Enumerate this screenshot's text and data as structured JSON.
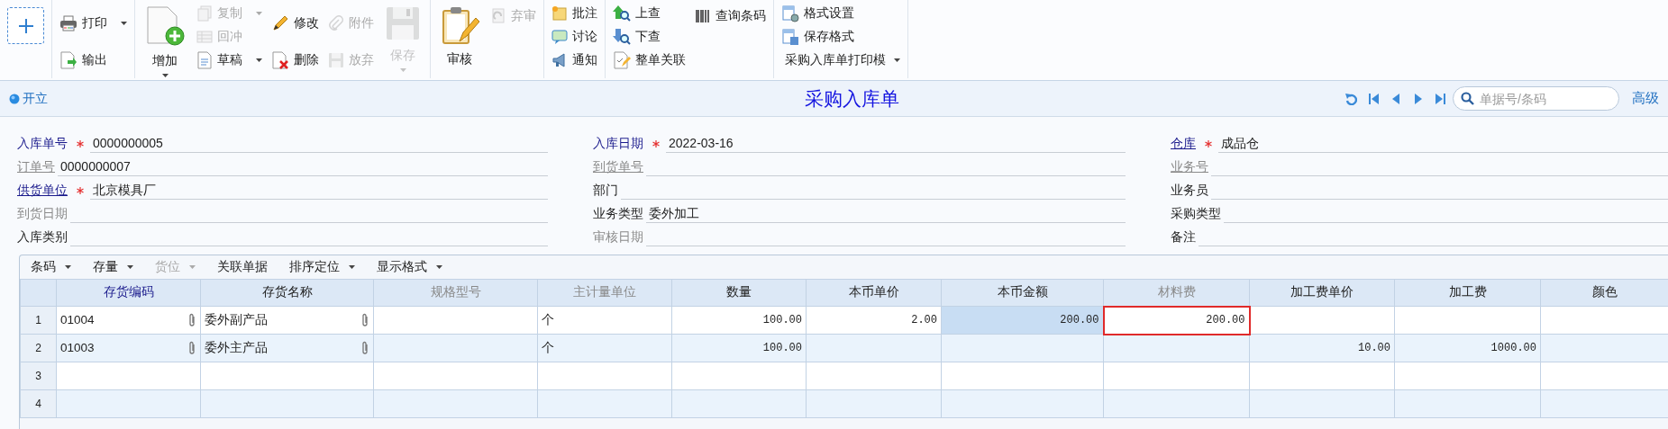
{
  "toolbar": {
    "groups": [
      {
        "columns": [
          [
            {
              "kind": "plus",
              "disabled": false,
              "dropdown": false
            }
          ]
        ]
      },
      {
        "columns": [
          [
            {
              "kind": "small",
              "label": "打印",
              "disabled": false,
              "dropdown": true
            },
            {
              "kind": "small",
              "label": "输出",
              "disabled": false,
              "dropdown": false
            }
          ]
        ]
      },
      {
        "columns": [
          [
            {
              "kind": "big",
              "label": "增加",
              "disabled": false,
              "dropdown": true
            }
          ],
          [
            {
              "kind": "small",
              "label": "复制",
              "disabled": true,
              "dropdown": true
            },
            {
              "kind": "small",
              "label": "回冲",
              "disabled": true,
              "dropdown": false
            },
            {
              "kind": "small",
              "label": "草稿",
              "disabled": false,
              "dropdown": true
            }
          ],
          [
            {
              "kind": "small",
              "label": "修改",
              "disabled": false,
              "dropdown": false
            },
            {
              "kind": "small",
              "label": "删除",
              "disabled": false,
              "dropdown": false
            }
          ],
          [
            {
              "kind": "small",
              "label": "附件",
              "disabled": true,
              "dropdown": false
            },
            {
              "kind": "small",
              "label": "放弃",
              "disabled": true,
              "dropdown": false
            }
          ],
          [
            {
              "kind": "big",
              "label": "保存",
              "disabled": true,
              "dropdown": true
            }
          ]
        ]
      },
      {
        "columns": [
          [
            {
              "kind": "big",
              "label": "审核",
              "disabled": false,
              "dropdown": false
            }
          ],
          [
            {
              "kind": "small",
              "label": "弃审",
              "disabled": true,
              "dropdown": false
            }
          ]
        ]
      },
      {
        "columns": [
          [
            {
              "kind": "small",
              "label": "批注",
              "disabled": false,
              "dropdown": false
            },
            {
              "kind": "small",
              "label": "讨论",
              "disabled": false,
              "dropdown": false
            },
            {
              "kind": "small",
              "label": "通知",
              "disabled": false,
              "dropdown": false
            }
          ]
        ]
      },
      {
        "columns": [
          [
            {
              "kind": "small",
              "label": "上查",
              "disabled": false,
              "dropdown": false
            },
            {
              "kind": "small",
              "label": "下查",
              "disabled": false,
              "dropdown": false
            },
            {
              "kind": "small",
              "label": "整单关联",
              "disabled": false,
              "dropdown": false
            }
          ],
          [
            {
              "kind": "small",
              "label": "查询条码",
              "disabled": false,
              "dropdown": false
            }
          ]
        ]
      },
      {
        "columns": [
          [
            {
              "kind": "small",
              "label": "格式设置",
              "disabled": false,
              "dropdown": false
            },
            {
              "kind": "small",
              "label": "保存格式",
              "disabled": false,
              "dropdown": false
            },
            {
              "kind": "text",
              "label": "采购入库单打印模",
              "disabled": false,
              "dropdown": true
            }
          ]
        ]
      }
    ]
  },
  "header": {
    "status": "开立",
    "title": "采购入库单",
    "search": {
      "placeholder": "单据号/条码"
    },
    "advanced_link": "高级"
  },
  "form": {
    "columns": [
      [
        {
          "label": "入库单号",
          "value": "0000000005",
          "required": true,
          "link": false,
          "disabled": false
        },
        {
          "label": "订单号",
          "value": "0000000007",
          "required": false,
          "link": true,
          "disabled": true
        },
        {
          "label": "供货单位",
          "value": "北京模具厂",
          "required": true,
          "link": true,
          "disabled": false
        },
        {
          "label": "到货日期",
          "required": false,
          "link": false,
          "disabled": true
        },
        {
          "label": "入库类别",
          "required": false,
          "link": false,
          "disabled": false
        }
      ],
      [
        {
          "label": "入库日期",
          "value": "2022-03-16",
          "required": true,
          "link": false,
          "disabled": false
        },
        {
          "label": "到货单号",
          "required": false,
          "link": true,
          "disabled": true
        },
        {
          "label": "部门",
          "required": false,
          "link": false,
          "disabled": false
        },
        {
          "label": "业务类型",
          "value": "委外加工",
          "required": false,
          "link": false,
          "disabled": false
        },
        {
          "label": "审核日期",
          "required": false,
          "link": false,
          "disabled": true
        }
      ],
      [
        {
          "label": "仓库",
          "value": "成品仓",
          "required": true,
          "link": true,
          "disabled": false
        },
        {
          "label": "业务号",
          "required": false,
          "link": true,
          "disabled": true
        },
        {
          "label": "业务员",
          "required": false,
          "link": false,
          "disabled": false
        },
        {
          "label": "采购类型",
          "required": false,
          "link": false,
          "disabled": false
        },
        {
          "label": "备注",
          "required": false,
          "link": false,
          "disabled": false
        }
      ]
    ]
  },
  "table_toolbar": [
    {
      "label": "条码",
      "dropdown": true,
      "disabled": false
    },
    {
      "label": "存量",
      "dropdown": true,
      "disabled": false
    },
    {
      "label": "货位",
      "dropdown": true,
      "disabled": true
    },
    {
      "label": "关联单据",
      "dropdown": false,
      "disabled": false
    },
    {
      "label": "排序定位",
      "dropdown": true,
      "disabled": false
    },
    {
      "label": "显示格式",
      "dropdown": true,
      "disabled": false
    }
  ],
  "table": {
    "columns": [
      {
        "label": "存货编码",
        "kind": "link"
      },
      {
        "label": "存货名称",
        "kind": "normal"
      },
      {
        "label": "规格型号",
        "kind": "disabled"
      },
      {
        "label": "主计量单位",
        "kind": "disabled"
      },
      {
        "label": "数量",
        "kind": "normal"
      },
      {
        "label": "本币单价",
        "kind": "normal"
      },
      {
        "label": "本币金额",
        "kind": "normal"
      },
      {
        "label": "材料费",
        "kind": "disabled"
      },
      {
        "label": "加工费单价",
        "kind": "normal"
      },
      {
        "label": "加工费",
        "kind": "normal"
      },
      {
        "label": "颜色",
        "kind": "normal"
      }
    ],
    "rows": [
      {
        "number": "1",
        "cells": [
          {
            "kind": "text",
            "text": "01004",
            "attachment": true,
            "highlighted": false,
            "focused": false
          },
          {
            "kind": "text",
            "text": "委外副产品",
            "attachment": true,
            "highlighted": false,
            "focused": false
          },
          {
            "attachment": false,
            "highlighted": false,
            "focused": false
          },
          {
            "kind": "text",
            "text": "个",
            "attachment": false,
            "highlighted": false,
            "focused": false
          },
          {
            "kind": "number",
            "text": "100.00",
            "attachment": false,
            "highlighted": false,
            "focused": false
          },
          {
            "kind": "number",
            "text": "2.00",
            "attachment": false,
            "highlighted": false,
            "focused": false
          },
          {
            "kind": "number",
            "text": "200.00",
            "attachment": false,
            "highlighted": true,
            "focused": false
          },
          {
            "kind": "number",
            "text": "200.00",
            "attachment": false,
            "highlighted": false,
            "focused": true
          },
          {
            "attachment": false,
            "highlighted": false,
            "focused": false
          },
          {
            "attachment": false,
            "highlighted": false,
            "focused": false
          },
          {
            "attachment": false,
            "highlighted": false,
            "focused": false
          }
        ]
      },
      {
        "number": "2",
        "cells": [
          {
            "kind": "text",
            "text": "01003",
            "attachment": true,
            "highlighted": false,
            "focused": false
          },
          {
            "kind": "text",
            "text": "委外主产品",
            "attachment": true,
            "highlighted": false,
            "focused": false
          },
          {
            "attachment": false,
            "highlighted": false,
            "focused": false
          },
          {
            "kind": "text",
            "text": "个",
            "attachment": false,
            "highlighted": false,
            "focused": false
          },
          {
            "kind": "number",
            "text": "100.00",
            "attachment": false,
            "highlighted": false,
            "focused": false
          },
          {
            "attachment": false,
            "highlighted": false,
            "focused": false
          },
          {
            "attachment": false,
            "highlighted": false,
            "focused": false
          },
          {
            "attachment": false,
            "highlighted": false,
            "focused": false
          },
          {
            "kind": "number",
            "text": "10.00",
            "attachment": false,
            "highlighted": false,
            "focused": false
          },
          {
            "kind": "number",
            "text": "1000.00",
            "attachment": false,
            "highlighted": false,
            "focused": false
          },
          {
            "attachment": false,
            "highlighted": false,
            "focused": false
          }
        ]
      },
      {
        "number": "3",
        "cells": [
          {
            "attachment": false,
            "highlighted": false,
            "focused": false
          },
          {
            "attachment": false,
            "highlighted": false,
            "focused": false
          },
          {
            "attachment": false,
            "highlighted": false,
            "focused": false
          },
          {
            "attachment": false,
            "highlighted": false,
            "focused": false
          },
          {
            "attachment": false,
            "highlighted": false,
            "focused": false
          },
          {
            "attachment": false,
            "highlighted": false,
            "focused": false
          },
          {
            "attachment": false,
            "highlighted": false,
            "focused": false
          },
          {
            "attachment": false,
            "highlighted": false,
            "focused": false
          },
          {
            "attachment": false,
            "highlighted": false,
            "focused": false
          },
          {
            "attachment": false,
            "highlighted": false,
            "focused": false
          },
          {
            "attachment": false,
            "highlighted": false,
            "focused": false
          }
        ]
      },
      {
        "number": "4",
        "cells": [
          {
            "attachment": false,
            "highlighted": false,
            "focused": false
          },
          {
            "attachment": false,
            "highlighted": false,
            "focused": false
          },
          {
            "attachment": false,
            "highlighted": false,
            "focused": false
          },
          {
            "attachment": false,
            "highlighted": false,
            "focused": false
          },
          {
            "attachment": false,
            "highlighted": false,
            "focused": false
          },
          {
            "attachment": false,
            "highlighted": false,
            "focused": false
          },
          {
            "attachment": false,
            "highlighted": false,
            "focused": false
          },
          {
            "attachment": false,
            "highlighted": false,
            "focused": false
          },
          {
            "attachment": false,
            "highlighted": false,
            "focused": false
          },
          {
            "attachment": false,
            "highlighted": false,
            "focused": false
          },
          {
            "attachment": false,
            "highlighted": false,
            "focused": false
          }
        ]
      }
    ]
  }
}
